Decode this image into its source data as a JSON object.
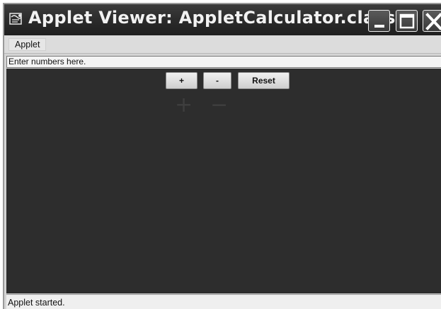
{
  "window": {
    "title": "Applet Viewer: AppletCalculator.class",
    "icon": "applet-viewer-icon",
    "controls": {
      "minimize_icon": "minimize-icon",
      "maximize_icon": "maximize-icon",
      "close_icon": "close-icon"
    }
  },
  "menubar": {
    "items": [
      {
        "label": "Applet"
      }
    ]
  },
  "input": {
    "value": "Enter numbers here."
  },
  "buttons": {
    "add_label": "+",
    "subtract_label": "-",
    "reset_label": "Reset"
  },
  "operators": {
    "plus_glyph": "+",
    "minus_glyph": "−"
  },
  "status": {
    "text": "Applet started."
  },
  "colors": {
    "titlebar": "#2a2a2a",
    "content_bg": "#2d2d2d",
    "status_bg": "#efefef"
  }
}
